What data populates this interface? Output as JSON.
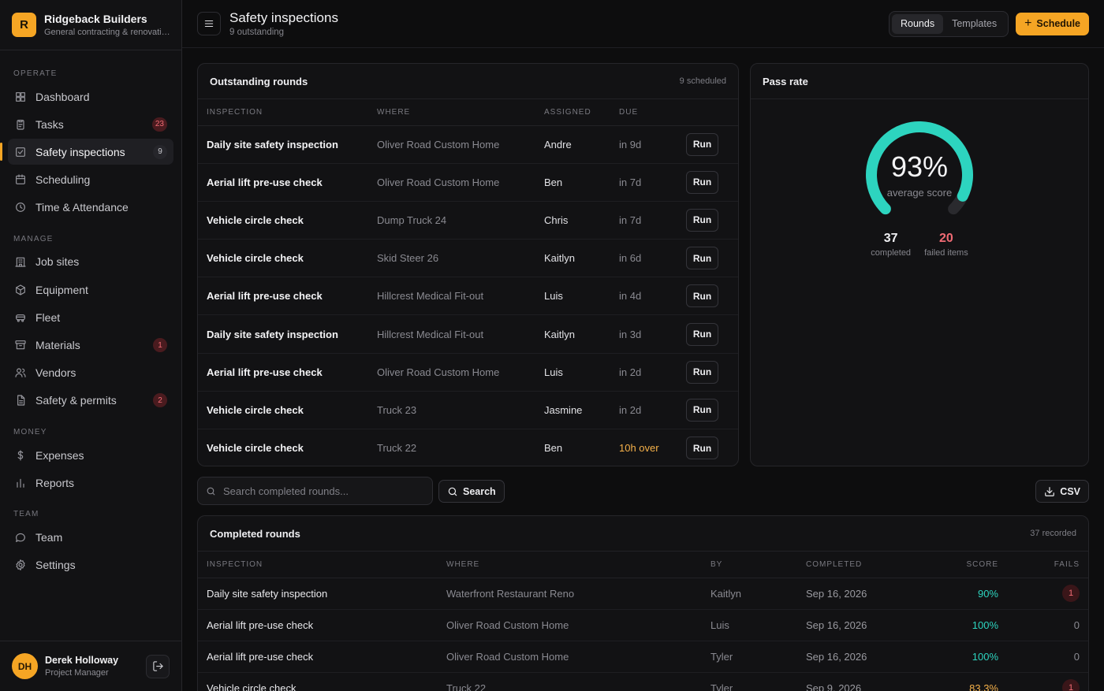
{
  "brand": {
    "initial": "R",
    "name": "Ridgeback Builders",
    "subtitle": "General contracting & renovations"
  },
  "nav": {
    "sections": {
      "operate": "OPERATE",
      "manage": "MANAGE",
      "money": "MONEY",
      "team": "TEAM"
    },
    "items": [
      {
        "label": "Dashboard",
        "icon": "grid-icon"
      },
      {
        "label": "Tasks",
        "icon": "clipboard-icon",
        "badge": "23"
      },
      {
        "label": "Safety inspections",
        "icon": "checkbox-icon",
        "badge": "9"
      },
      {
        "label": "Scheduling",
        "icon": "calendar-icon"
      },
      {
        "label": "Time & Attendance",
        "icon": "clock-icon"
      },
      {
        "label": "Job sites",
        "icon": "building-icon"
      },
      {
        "label": "Equipment",
        "icon": "box-icon"
      },
      {
        "label": "Fleet",
        "icon": "truck-icon"
      },
      {
        "label": "Materials",
        "icon": "archive-icon",
        "badge": "1"
      },
      {
        "label": "Vendors",
        "icon": "users-icon"
      },
      {
        "label": "Safety & permits",
        "icon": "document-icon",
        "badge": "2"
      },
      {
        "label": "Expenses",
        "icon": "dollar-icon"
      },
      {
        "label": "Reports",
        "icon": "bar-chart-icon"
      },
      {
        "label": "Team",
        "icon": "chat-icon"
      },
      {
        "label": "Settings",
        "icon": "gear-icon"
      }
    ]
  },
  "user": {
    "initials": "DH",
    "name": "Derek Holloway",
    "role": "Project Manager"
  },
  "header": {
    "title": "Safety inspections",
    "subtitle": "9 outstanding",
    "tabs": [
      "Rounds",
      "Templates"
    ],
    "schedule_label": "Schedule"
  },
  "outstanding": {
    "title": "Outstanding rounds",
    "meta": "9 scheduled",
    "columns": [
      "INSPECTION",
      "WHERE",
      "ASSIGNED",
      "DUE"
    ],
    "run_label": "Run",
    "rows": [
      {
        "name": "Daily site safety inspection",
        "where": "Oliver Road Custom Home",
        "assigned": "Andre",
        "due": "in 9d"
      },
      {
        "name": "Aerial lift pre-use check",
        "where": "Oliver Road Custom Home",
        "assigned": "Ben",
        "due": "in 7d"
      },
      {
        "name": "Vehicle circle check",
        "where": "Dump Truck 24",
        "assigned": "Chris",
        "due": "in 7d"
      },
      {
        "name": "Vehicle circle check",
        "where": "Skid Steer 26",
        "assigned": "Kaitlyn",
        "due": "in 6d"
      },
      {
        "name": "Aerial lift pre-use check",
        "where": "Hillcrest Medical Fit-out",
        "assigned": "Luis",
        "due": "in 4d"
      },
      {
        "name": "Daily site safety inspection",
        "where": "Hillcrest Medical Fit-out",
        "assigned": "Kaitlyn",
        "due": "in 3d"
      },
      {
        "name": "Aerial lift pre-use check",
        "where": "Oliver Road Custom Home",
        "assigned": "Luis",
        "due": "in 2d"
      },
      {
        "name": "Vehicle circle check",
        "where": "Truck 23",
        "assigned": "Jasmine",
        "due": "in 2d"
      },
      {
        "name": "Vehicle circle check",
        "where": "Truck 22",
        "assigned": "Ben",
        "due": "10h over",
        "overdue": true
      }
    ]
  },
  "pass_rate": {
    "title": "Pass rate",
    "value": "93%",
    "fraction": 0.93,
    "label": "average score",
    "completed": "37",
    "completed_label": "completed",
    "failed": "20",
    "failed_label": "failed items",
    "colors": {
      "accent": "#2dd4bf",
      "track": "#2a2a2e"
    }
  },
  "search": {
    "placeholder": "Search completed rounds...",
    "button": "Search",
    "csv": "CSV"
  },
  "completed": {
    "title": "Completed rounds",
    "meta": "37 recorded",
    "columns": [
      "INSPECTION",
      "WHERE",
      "BY",
      "COMPLETED",
      "SCORE",
      "FAILS"
    ],
    "rows": [
      {
        "name": "Daily site safety inspection",
        "where": "Waterfront Restaurant Reno",
        "by": "Kaitlyn",
        "date": "Sep 16, 2026",
        "score": "90%",
        "fails": "1"
      },
      {
        "name": "Aerial lift pre-use check",
        "where": "Oliver Road Custom Home",
        "by": "Luis",
        "date": "Sep 16, 2026",
        "score": "100%",
        "fails": "0"
      },
      {
        "name": "Aerial lift pre-use check",
        "where": "Oliver Road Custom Home",
        "by": "Tyler",
        "date": "Sep 16, 2026",
        "score": "100%",
        "fails": "0"
      },
      {
        "name": "Vehicle circle check",
        "where": "Truck 22",
        "by": "Tyler",
        "date": "Sep 9, 2026",
        "score": "83.3%",
        "fails": "1",
        "warn": true
      }
    ]
  }
}
